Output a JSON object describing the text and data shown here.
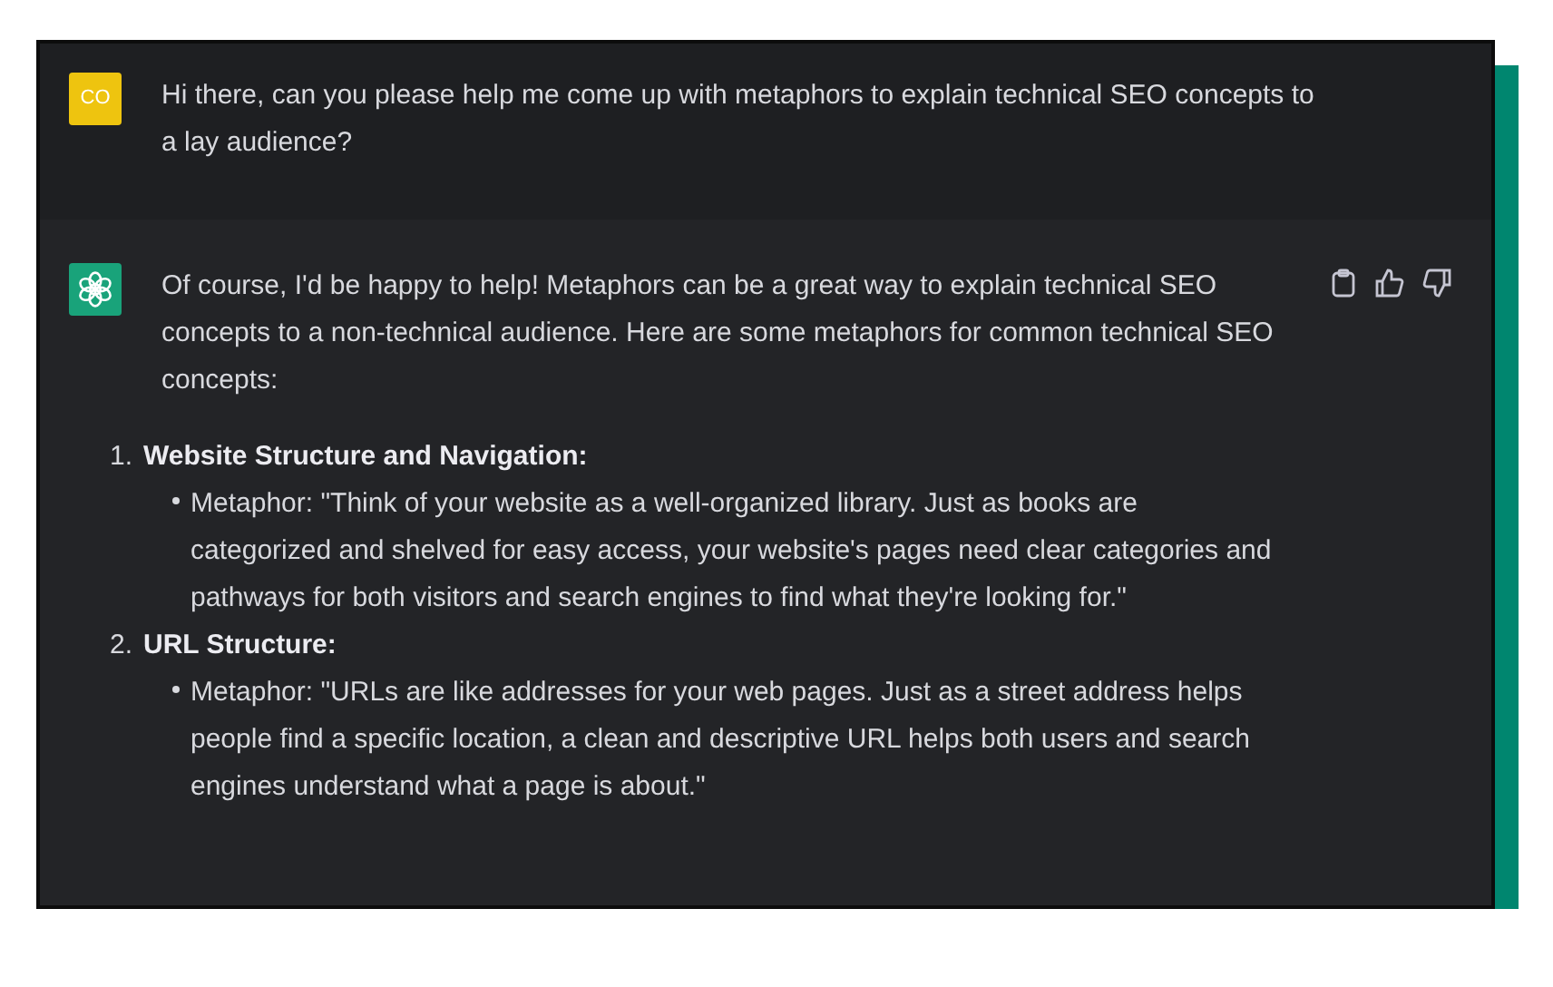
{
  "user_message": {
    "avatar": "CO",
    "text": "Hi there, can you please help me come up with metaphors to explain technical SEO concepts to a lay audience?"
  },
  "assistant_message": {
    "intro": "Of course, I'd be happy to help! Metaphors can be a great way to explain technical SEO concepts to a non-technical audience. Here are some metaphors for common technical SEO concepts:",
    "items": [
      {
        "number": "1.",
        "title": "Website Structure and Navigation:",
        "bullets": [
          "Metaphor: \"Think of your website as a well-organized library. Just as books are categorized and shelved for easy access, your website's pages need clear categories and pathways for both visitors and search engines to find what they're looking for.\""
        ]
      },
      {
        "number": "2.",
        "title": "URL Structure:",
        "bullets": [
          "Metaphor: \"URLs are like addresses for your web pages. Just as a street address helps people find a specific location, a clean and descriptive URL helps both users and search engines understand what a page is about.\""
        ]
      }
    ]
  }
}
